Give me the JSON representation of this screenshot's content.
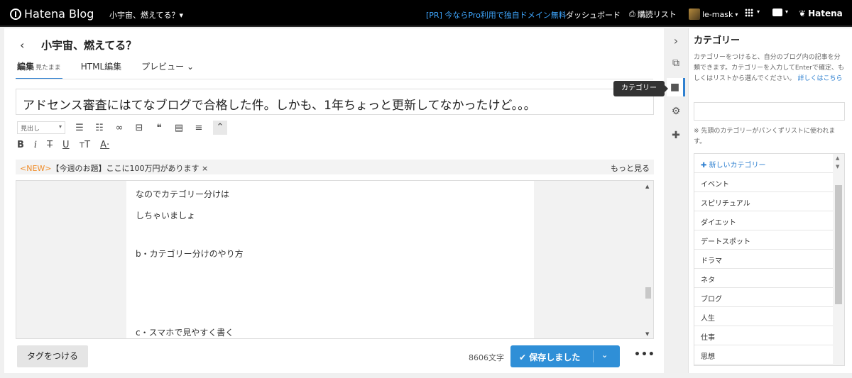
{
  "topbar": {
    "logo_text": "Hatena Blog",
    "blog_name": "小宇宙、燃えてる？▾",
    "pr_text": "[PR] 今ならPro利用で独自ドメイン無料",
    "dashboard": "ダッシュボード",
    "reading_list": "購読リスト",
    "user_name": "le-mask",
    "hatena": "Hatena"
  },
  "header": {
    "back_glyph": "‹",
    "title": "小宇宙、燃えてる？"
  },
  "tabs": [
    {
      "label": "編集",
      "sub": "見たまま"
    },
    {
      "label": "HTML編集",
      "sub": ""
    },
    {
      "label": "プレビュー ⌄",
      "sub": ""
    }
  ],
  "entry_title": "アドセンス審査にはてなブログで合格した件。しかも、1年ちょっと更新してなかったけど。。。",
  "toolbar": {
    "heading_select": "見出し",
    "format_b": "B",
    "format_i": "i",
    "format_s": "T",
    "format_u": "U",
    "format_size": "тT",
    "format_color": "A·"
  },
  "notice": {
    "new_tag": "<NEW>",
    "text": "【今週のお題】ここに100万円があります ×",
    "more": "もっと見る"
  },
  "editor_lines": [
    "なのでカテゴリー分けは",
    "しちゃいましょ",
    "b・カテゴリー分けのやり方",
    "c・スマホで見やすく書く"
  ],
  "footer": {
    "tag_button": "タグをつける",
    "char_count": "8606文字",
    "save_button": "✔ 保存しました",
    "save_dropdown": "⌄",
    "more": "•••"
  },
  "rail": {
    "tooltip": "カテゴリー"
  },
  "category_panel": {
    "title": "カテゴリー",
    "description": "カテゴリーをつけると、自分のブログ内の記事を分類できます。カテゴリーを入力してEnterで確定、もしくはリストから選んでください。",
    "help_link": "詳しくはこちら",
    "note": "※ 先頭のカテゴリーがパンくずリストに使われます。",
    "new_category": "✚ 新しいカテゴリー",
    "items": [
      "イベント",
      "スピリチュアル",
      "ダイエット",
      "デートスポット",
      "ドラマ",
      "ネタ",
      "ブログ",
      "人生",
      "仕事",
      "思想"
    ]
  }
}
